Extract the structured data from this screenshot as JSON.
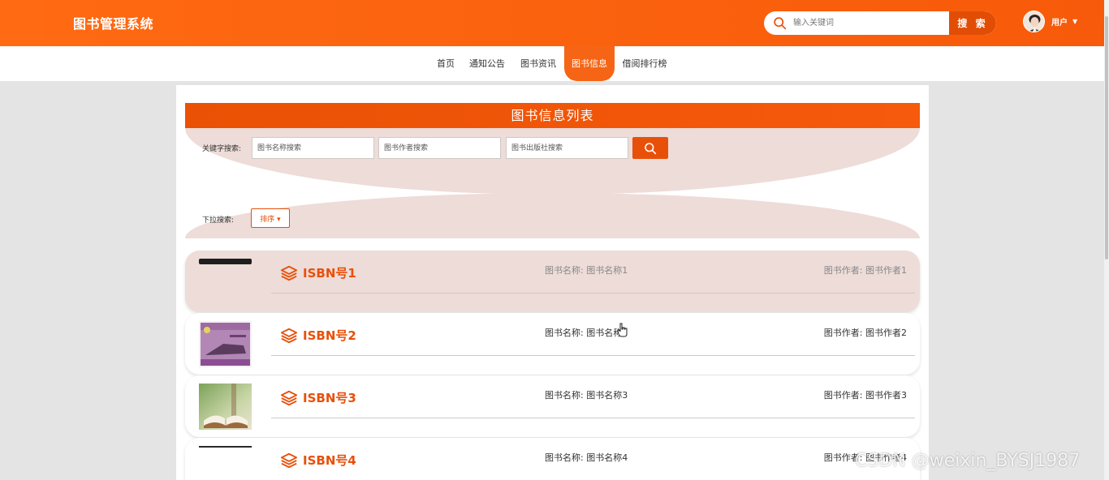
{
  "header": {
    "brand": "图书管理系统",
    "search_placeholder": "输入关键词",
    "search_button": "搜 索",
    "user_label": "用户"
  },
  "nav": {
    "items": [
      {
        "label": "首页",
        "active": false
      },
      {
        "label": "通知公告",
        "active": false
      },
      {
        "label": "图书资讯",
        "active": false
      },
      {
        "label": "图书信息",
        "active": true
      },
      {
        "label": "借阅排行榜",
        "active": false
      }
    ]
  },
  "list": {
    "title": "图书信息列表",
    "keyword_label": "关键字搜索:",
    "name_placeholder": "图书名称搜索",
    "author_placeholder": "图书作者搜索",
    "publisher_placeholder": "图书出版社搜索",
    "dropdown_label": "下拉搜索:",
    "sort_label": "排序 ▾"
  },
  "books": [
    {
      "isbn": "ISBN号1",
      "name": "图书名称: 图书名称1",
      "author": "图书作者: 图书作者1"
    },
    {
      "isbn": "ISBN号2",
      "name": "图书名称: 图书名称2",
      "author": "图书作者: 图书作者2"
    },
    {
      "isbn": "ISBN号3",
      "name": "图书名称: 图书名称3",
      "author": "图书作者: 图书作者3"
    },
    {
      "isbn": "ISBN号4",
      "name": "图书名称: 图书名称4",
      "author": "图书作者: 图书作者4"
    }
  ],
  "watermark": "CSDN @weixin_BYSJ1987",
  "colors": {
    "accent": "#f56515",
    "accent_dark": "#e8500a",
    "soft_pink": "#eddcd8"
  }
}
